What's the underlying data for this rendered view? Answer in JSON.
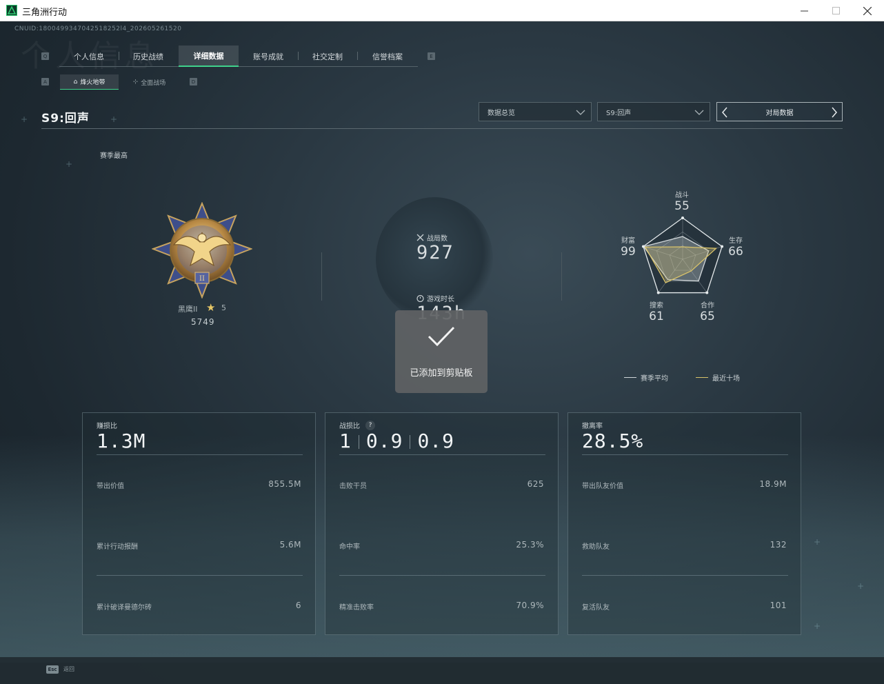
{
  "window": {
    "title": "三角洲行动",
    "min_icon": "minimize-icon",
    "max_icon": "maximize-icon",
    "close_icon": "close-icon"
  },
  "header": {
    "cnuid": "CNUID:1800499347042518252l4_202605261520",
    "ghost_title": "个人信息",
    "tab_keys": {
      "left": "Q",
      "right": "E"
    },
    "tabs": [
      {
        "label": "个人信息"
      },
      {
        "label": "历史战绩"
      },
      {
        "label": "详细数据"
      },
      {
        "label": "账号成就"
      },
      {
        "label": "社交定制"
      },
      {
        "label": "信誉档案"
      }
    ],
    "active_tab": "详细数据",
    "subtab_keys": {
      "left": "A",
      "right": "D"
    },
    "subtabs": [
      {
        "label": "烽火地带",
        "icon": "outpost-icon"
      },
      {
        "label": "全面战场",
        "icon": "crosshair-icon"
      }
    ]
  },
  "season": {
    "title": "S9:回声",
    "filter_dropdown": "数据总览",
    "season_dropdown": "S9:回声",
    "pager_label": "对局数据"
  },
  "summary": {
    "best_label": "赛季最高",
    "rank_name": "黑鹰II",
    "rank_stars": "5",
    "rank_score": "5749",
    "matches_label": "战局数",
    "matches_value": "927",
    "playtime_label": "游戏时长",
    "playtime_value": "143h"
  },
  "radar": {
    "axes": [
      {
        "label": "战斗",
        "value": "55"
      },
      {
        "label": "生存",
        "value": "66"
      },
      {
        "label": "合作",
        "value": "65"
      },
      {
        "label": "搜索",
        "value": "61"
      },
      {
        "label": "财富",
        "value": "99"
      }
    ],
    "season_avg": [
      0.55,
      0.66,
      0.65,
      0.61,
      0.99
    ],
    "recent_ten": [
      0.3,
      0.85,
      0.35,
      0.7,
      0.95
    ],
    "legend": {
      "season_avg": "赛季平均",
      "recent": "最近十场"
    },
    "colors": {
      "season_avg": "#d0d6d9",
      "recent": "#d9c36a"
    }
  },
  "toast": {
    "text": "已添加到剪贴板",
    "icon": "checkmark-icon"
  },
  "cards": [
    {
      "title": "赚损比",
      "value": "1.3M",
      "rows": [
        {
          "label": "带出价值",
          "value": "855.5M"
        },
        {
          "label": "累计行动报酬",
          "value": "5.6M"
        },
        {
          "label": "累计破译曼德尔砖",
          "value": "6"
        }
      ]
    },
    {
      "title": "战损比",
      "help": "?",
      "values": [
        "1",
        "0.9",
        "0.9"
      ],
      "rows": [
        {
          "label": "击败干员",
          "value": "625"
        },
        {
          "label": "命中率",
          "value": "25.3%"
        },
        {
          "label": "精准击败率",
          "value": "70.9%"
        }
      ]
    },
    {
      "title": "撤离率",
      "value": "28.5%",
      "rows": [
        {
          "label": "带出队友价值",
          "value": "18.9M"
        },
        {
          "label": "救助队友",
          "value": "132"
        },
        {
          "label": "复活队友",
          "value": "101"
        }
      ]
    }
  ],
  "footer": {
    "esc_key": "Esc",
    "back_label": "返回"
  }
}
